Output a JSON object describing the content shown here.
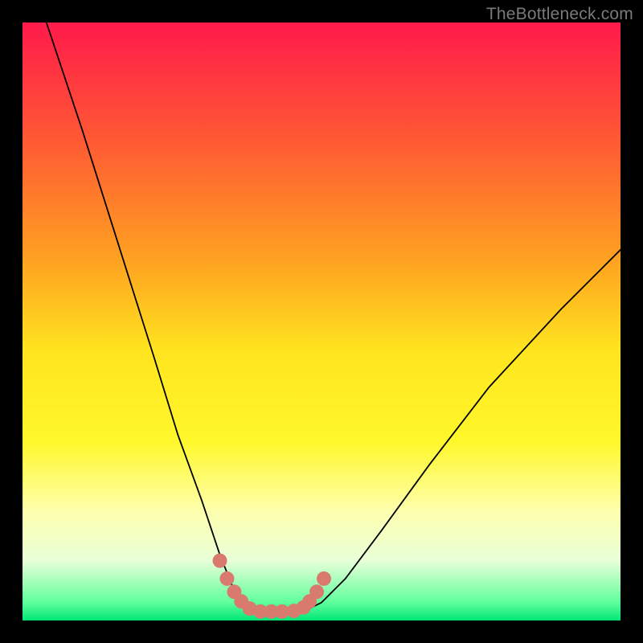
{
  "watermark": "TheBottleneck.com",
  "chart_data": {
    "type": "line",
    "title": "",
    "xlabel": "",
    "ylabel": "",
    "xlim": [
      0,
      100
    ],
    "ylim": [
      0,
      100
    ],
    "grid": false,
    "legend": false,
    "background_gradient": {
      "stops": [
        {
          "pos": 0.0,
          "color": "#ff1a4b"
        },
        {
          "pos": 0.2,
          "color": "#ff5a33"
        },
        {
          "pos": 0.4,
          "color": "#ffa321"
        },
        {
          "pos": 0.55,
          "color": "#ffe51f"
        },
        {
          "pos": 0.7,
          "color": "#fff82a"
        },
        {
          "pos": 0.82,
          "color": "#fdffb0"
        },
        {
          "pos": 0.9,
          "color": "#e8ffd8"
        },
        {
          "pos": 0.97,
          "color": "#5fff9c"
        },
        {
          "pos": 1.0,
          "color": "#00e676"
        }
      ]
    },
    "series": [
      {
        "name": "bottleneck-curve",
        "color": "#000000",
        "width": 1.8,
        "x": [
          4,
          10,
          16,
          22,
          26,
          30,
          33,
          35,
          37,
          39,
          43,
          47,
          50,
          54,
          60,
          68,
          78,
          90,
          100
        ],
        "y": [
          100,
          82,
          63,
          44,
          31,
          20,
          11,
          6,
          3,
          1.5,
          1.5,
          1.5,
          3,
          7,
          15,
          26,
          39,
          52,
          62
        ]
      },
      {
        "name": "highlight-dots",
        "color": "#d87a6e",
        "type": "scatter",
        "marker_size": 18,
        "x": [
          33.0,
          34.2,
          35.4,
          36.6,
          38.0,
          39.8,
          41.6,
          43.4,
          45.4,
          47.0,
          48.0,
          49.2,
          50.4
        ],
        "y": [
          10.0,
          7.0,
          4.8,
          3.2,
          2.0,
          1.5,
          1.5,
          1.5,
          1.6,
          2.2,
          3.2,
          4.8,
          7.0
        ]
      }
    ]
  }
}
